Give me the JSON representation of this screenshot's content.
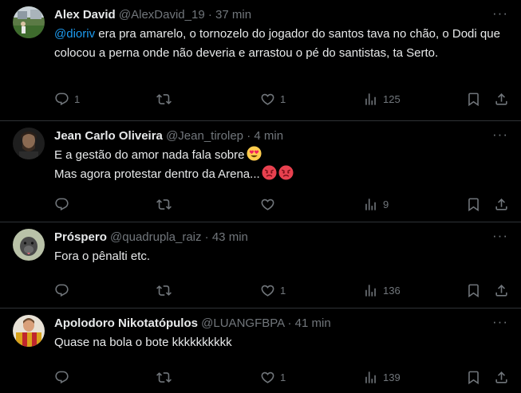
{
  "tweets": [
    {
      "name": "Alex David",
      "handle": "@AlexDavid_19",
      "dot": "·",
      "time": "37 min",
      "mention": "@dioriv",
      "text": " era pra amarelo, o tornozelo do jogador do santos tava no chão, o Dodi que colocou a perna onde não deveria e arrastou o pé do santistas, ta Serto.",
      "replies": "1",
      "retweets": "",
      "likes": "1",
      "views": "125"
    },
    {
      "name": "Jean Carlo Oliveira",
      "handle": "@Jean_tirolep",
      "dot": "·",
      "time": "4 min",
      "line1": "E a gestão do amor nada fala sobre",
      "line2": "Mas agora protestar dentro da Arena...",
      "emoji1": "smiling-face-with-heart-eyes",
      "emoji2": "angry-face",
      "replies": "",
      "retweets": "",
      "likes": "",
      "views": "9"
    },
    {
      "name": "Próspero",
      "handle": "@quadrupla_raiz",
      "dot": "·",
      "time": "43 min",
      "text": "Fora o pênalti etc.",
      "replies": "",
      "retweets": "",
      "likes": "1",
      "views": "136"
    },
    {
      "name": "Apolodoro Nikotatópulos",
      "handle": "@LUANGFBPA",
      "dot": "·",
      "time": "41 min",
      "text": "Quase na bola o bote kkkkkkkkkk",
      "replies": "",
      "retweets": "",
      "likes": "1",
      "views": "139"
    }
  ],
  "colors": {
    "background": "#000000",
    "text": "#e7e9ea",
    "muted": "#71767b",
    "link": "#1d9bf0",
    "divider": "#2f3336"
  },
  "icons": {
    "reply": "reply-icon",
    "retweet": "retweet-icon",
    "like": "heart-icon",
    "views": "views-icon",
    "bookmark": "bookmark-icon",
    "share": "share-icon",
    "more": "more-icon"
  }
}
